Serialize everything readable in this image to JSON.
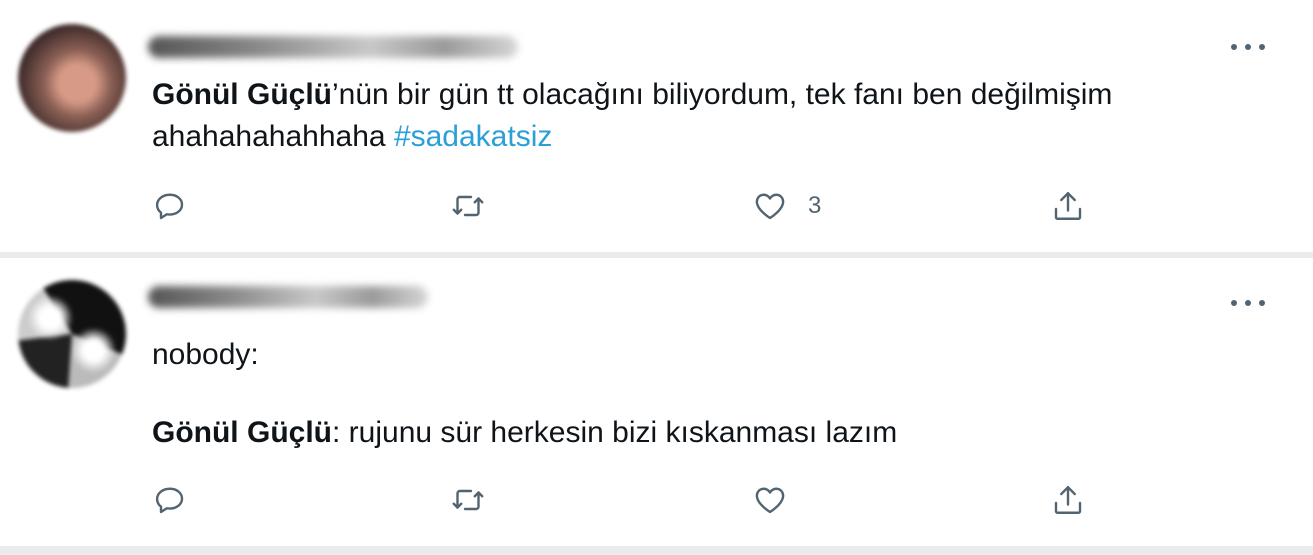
{
  "colors": {
    "hashtag": "#2b9fd8",
    "icon": "#536471"
  },
  "tweets": [
    {
      "avatar": "user-avatar-blurred",
      "line1_bold": "Gönül Güçlü",
      "line1_rest": "’nün bir gün tt olacağını biliyordum, tek fanı ben değilmişim",
      "line2_text": "ahahahahahhaha",
      "hashtag": "#sadakatsiz",
      "actions": {
        "reply": "reply-icon",
        "retweet": "retweet-icon",
        "like": "heart-icon",
        "like_count": "3",
        "share": "share-icon"
      }
    },
    {
      "avatar": "user-avatar-blurred",
      "line1_text": "nobody:",
      "line2_bold": "Gönül Güçlü",
      "line2_rest": ": rujunu sür herkesin bizi kıskanması lazım",
      "actions": {
        "reply": "reply-icon",
        "retweet": "retweet-icon",
        "like": "heart-icon",
        "share": "share-icon"
      }
    }
  ]
}
